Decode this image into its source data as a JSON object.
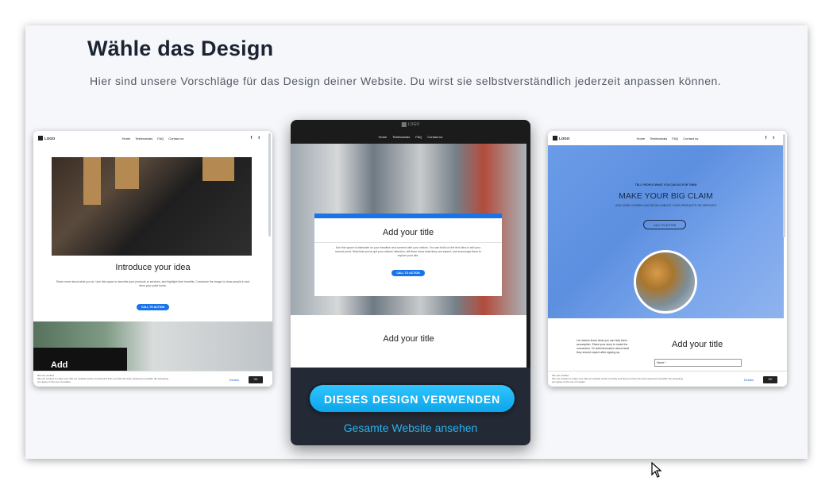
{
  "page": {
    "title": "Wähle das Design",
    "subtitle": "Hier sind unsere Vorschläge für das Design deiner Website. Du wirst sie selbstverständlich jederzeit anpassen können."
  },
  "mini_nav": {
    "logo": "LOGO",
    "links": [
      "Home",
      "Testimonials",
      "FAQ",
      "Contact us"
    ],
    "social": [
      "f",
      "t"
    ]
  },
  "left_template": {
    "heading": "Introduce your idea",
    "text": "Share more about what you do. Use this space to describe your products or services, and highlight their benefits. Customize the image to show people in and drive your point home.",
    "cta": "CALL TO ACTION",
    "section_heading": "Add"
  },
  "middle_template": {
    "logo": "LOGO",
    "box_title": "Add your title",
    "box_text": "Use this space to elaborate on your headline and connect with your visitors. You can build on the first idea or add your second point. Most that you've got your visitors' attention, tell them know what they can expect, and encourage them to explore your site.",
    "box_cta": "CALL TO ACTION",
    "section_title": "Add your title",
    "use_button": "DIESES DESIGN VERWENDEN",
    "view_link": "Gesamte Website ansehen"
  },
  "right_template": {
    "tagline": "TELL PEOPLE WHAT YOU CAN DO FOR THEM",
    "claim": "MAKE YOUR BIG CLAIM",
    "sub": "ADD SOME COMPELLING DETAILS ABOUT YOUR PRODUCTS OR SERVICES",
    "cta": "CALL TO ACTION",
    "text": "Let visitors know what you can help them accomplish. Share your story to make the connection. Or add information about what they should expect after signing up.",
    "section_title": "Add your title",
    "input_placeholder": "Name *"
  },
  "cookie": {
    "title": "We use cookies",
    "text": "We use cookies to make sure that our website works correctly and that you have the best experience possible. By accepting, you agree to the use of cookies.",
    "details": "Details",
    "ok": "OK"
  },
  "colors": {
    "accent": "#1a73e8",
    "cta_button": "#18b4f5",
    "link": "#2ab3f0",
    "dark_panel": "#232935"
  }
}
